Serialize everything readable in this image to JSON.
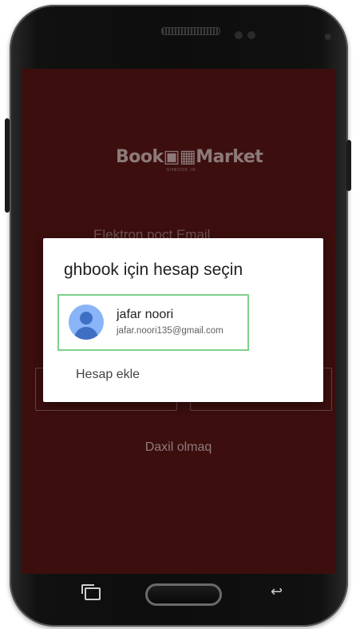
{
  "app": {
    "logo_text": "Book▣▦Market",
    "logo_subtitle": "GHBOOK.IR"
  },
  "background_form": {
    "email_label": "Elektron poçt Email",
    "login_link": "Daxil olmaq"
  },
  "dialog": {
    "title": "ghbook için hesap seçin",
    "accounts": [
      {
        "name": "jafar noori",
        "email": "jafar.noori135@gmail.com",
        "avatar_icon": "account-avatar-icon"
      }
    ],
    "add_account_label": "Hesap ekle"
  },
  "colors": {
    "app_background": "#4a1212",
    "selection_border": "#7fd18a",
    "avatar": "#8ab4f8"
  },
  "nav_icons": [
    "recent-apps-icon",
    "home-button",
    "back-icon"
  ]
}
